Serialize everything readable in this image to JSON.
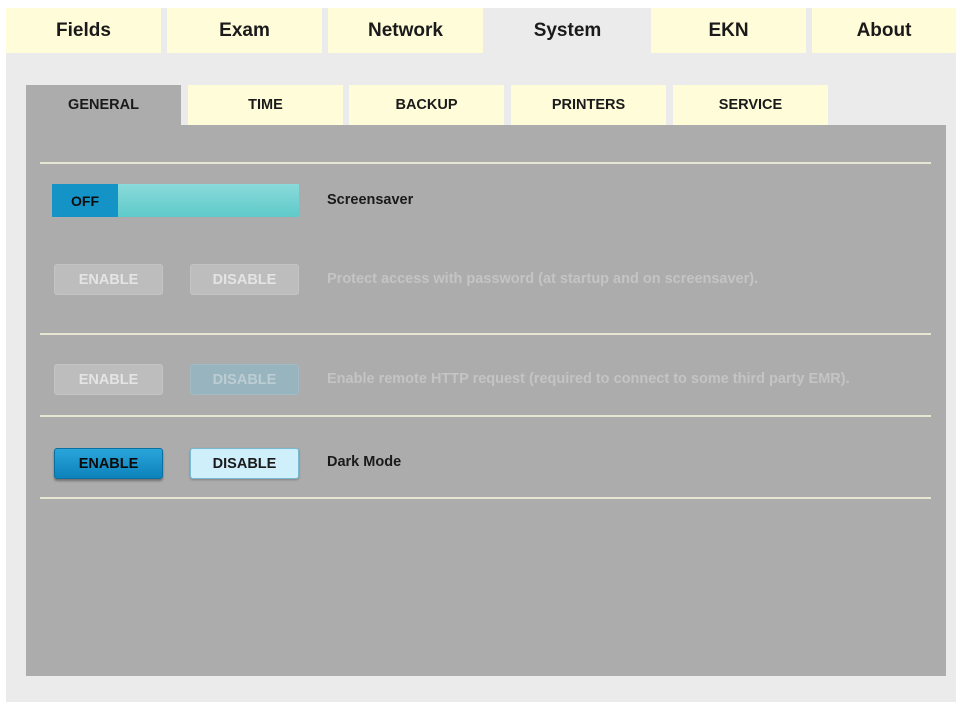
{
  "top_tabs": {
    "fields": "Fields",
    "exam": "Exam",
    "network": "Network",
    "system": "System",
    "ekn": "EKN",
    "about": "About"
  },
  "sub_tabs": {
    "general": "GENERAL",
    "time": "TIME",
    "backup": "BACKUP",
    "printers": "PRINTERS",
    "service": "SERVICE"
  },
  "settings": {
    "screensaver": {
      "toggle_state": "OFF",
      "label": "Screensaver"
    },
    "password": {
      "enable": "ENABLE",
      "disable": "DISABLE",
      "label": "Protect access with password (at startup and on screensaver)."
    },
    "http": {
      "enable": "ENABLE",
      "disable": "DISABLE",
      "label": "Enable remote HTTP request (required to connect to some third party EMR)."
    },
    "dark_mode": {
      "enable": "ENABLE",
      "disable": "DISABLE",
      "label": "Dark Mode"
    }
  },
  "colors": {
    "tab_bg": "#fffcd9",
    "panel_bg": "#acacac",
    "accent_blue": "#1493c6",
    "toggle_track": "#6fd0d0"
  }
}
